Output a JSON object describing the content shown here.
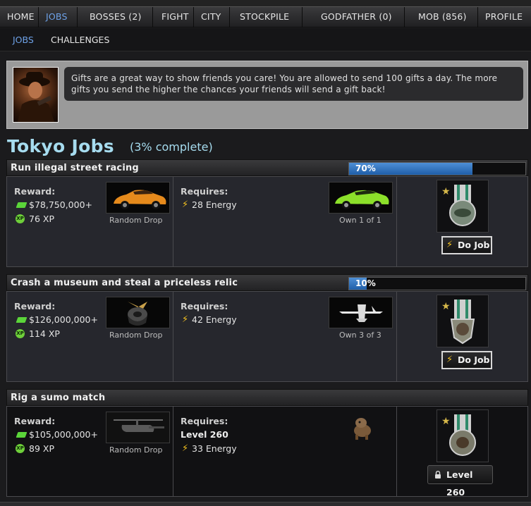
{
  "topnav": {
    "items": [
      {
        "label": "HOME"
      },
      {
        "label": "JOBS"
      },
      {
        "label": "BOSSES (2)"
      },
      {
        "label": "FIGHT"
      },
      {
        "label": "CITY"
      },
      {
        "label": "STOCKPILE"
      },
      {
        "label": "GODFATHER (0)"
      },
      {
        "label": "MOB (856)"
      },
      {
        "label": "PROFILE"
      }
    ],
    "active": "JOBS"
  },
  "subnav": {
    "items": [
      {
        "label": "JOBS"
      },
      {
        "label": "CHALLENGES"
      }
    ],
    "active": "JOBS"
  },
  "message": {
    "text": "Gifts are a great way to show friends you care! You are allowed to send 100 gifts a day. The more gifts you send the higher the chances your friends will send a gift back!"
  },
  "page": {
    "title": "Tokyo Jobs",
    "completion": "(3% complete)"
  },
  "colors": {
    "accent_blue": "#6ea2e8",
    "title_blue": "#a6dcef",
    "progress_blue": "#2f74c4",
    "energy_yellow": "#f6c320",
    "cash_green": "#5bd53a"
  },
  "labels": {
    "reward": "Reward:",
    "requires": "Requires:",
    "random_drop": "Random Drop",
    "do_job": "Do Job"
  },
  "jobs": [
    {
      "name": "Run illegal street racing",
      "progress_label": "70%",
      "progress": 0.7,
      "cash": "$78,750,000+",
      "xp": "76 XP",
      "drop_icon": "orange-sports-car-icon",
      "requirement_level": "",
      "energy": "28 Energy",
      "required_item_icon": "green-sports-car-icon",
      "own": "Own 1 of 1",
      "action": "Do Job",
      "locked": false
    },
    {
      "name": "Crash a museum and steal a priceless relic",
      "progress_label": "10%",
      "progress": 0.1,
      "cash": "$126,000,000+",
      "xp": "114 XP",
      "drop_icon": "samurai-helmet-icon",
      "requirement_level": "",
      "energy": "42 Energy",
      "required_item_icon": "drone-icon",
      "own": "Own 3 of 3",
      "action": "Do Job",
      "locked": false
    },
    {
      "name": "Rig a sumo match",
      "progress_label": "",
      "progress": 0,
      "cash": "$105,000,000+",
      "xp": "89 XP",
      "drop_icon": "helicopter-icon",
      "requirement_level": "Level 260",
      "energy": "33 Energy",
      "required_item_icon": "bulldog-icon",
      "own": "",
      "action": "Level 260",
      "locked": true
    }
  ],
  "xp_badge": "XP"
}
